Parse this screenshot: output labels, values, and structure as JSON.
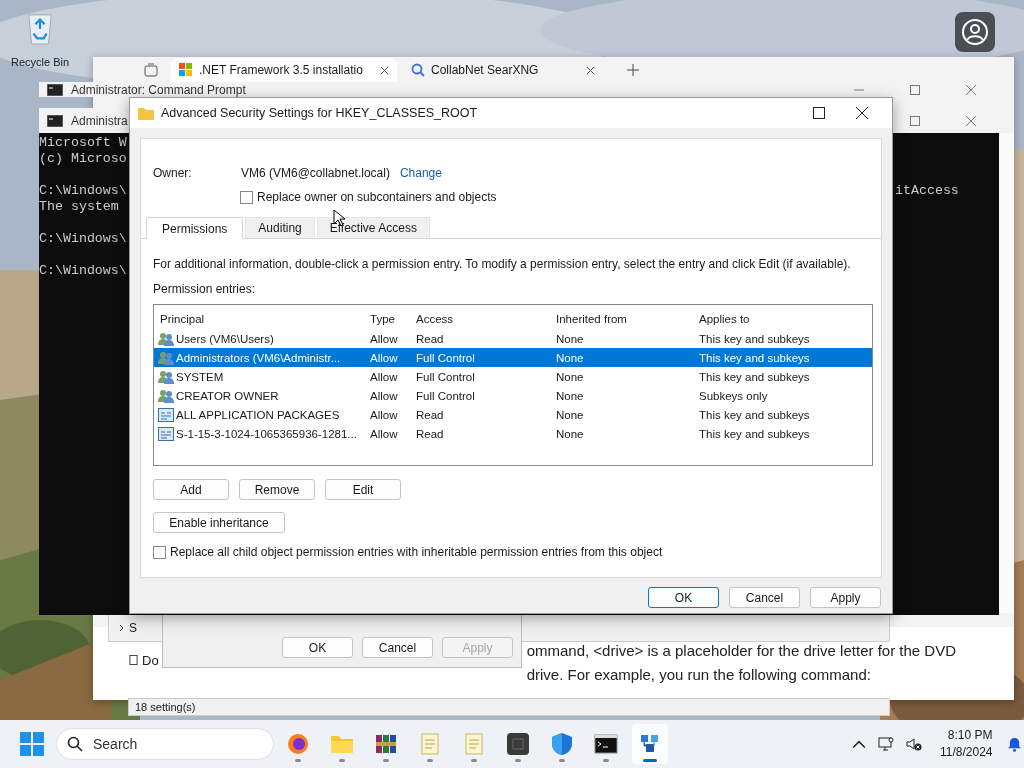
{
  "desktop": {
    "icons": [
      {
        "label": "Recycle Bin"
      }
    ]
  },
  "browser": {
    "tabs": [
      {
        "label": ".NET Framework 3.5 installatio",
        "selected": true,
        "kind": "windows"
      },
      {
        "label": "CollabNet SearXNG",
        "selected": false,
        "kind": "search"
      }
    ],
    "sidebar_item": "Do",
    "article_lines": [
      "ommand, <drive> is a placeholder for the drive letter for the DVD",
      "drive. For example, you run the following command:"
    ]
  },
  "policy_window": {
    "tree_item": "S",
    "status": "18 setting(s)"
  },
  "cmd_windows": [
    {
      "title": "Administrator: Command Prompt"
    },
    {
      "title": "Administra",
      "paragraphs": [
        [
          "Microsoft W",
          "(c) Microso"
        ],
        [
          "C:\\Windows\\",
          "The system"
        ],
        [
          "C:\\Windows\\"
        ],
        [
          "C:\\Windows\\"
        ]
      ],
      "right_fragment": "itAccess"
    }
  ],
  "back_dialog": {
    "buttons": [
      {
        "label": "OK",
        "disabled": false
      },
      {
        "label": "Cancel",
        "disabled": false
      },
      {
        "label": "Apply",
        "disabled": true
      }
    ]
  },
  "dialog": {
    "title": "Advanced Security Settings for HKEY_CLASSES_ROOT",
    "owner_label": "Owner:",
    "owner": "VM6 (VM6@collabnet.local)",
    "owner_link": "Change",
    "replace_owner": {
      "label": "Replace owner on subcontainers and objects",
      "checked": false
    },
    "tabs": [
      {
        "label": "Permissions",
        "selected": true
      },
      {
        "label": "Auditing",
        "selected": false
      },
      {
        "label": "Effective Access",
        "selected": false
      }
    ],
    "info": "For additional information, double-click a permission entry. To modify a permission entry, select the entry and click Edit (if available).",
    "entries_label": "Permission entries:",
    "table": {
      "columns": [
        "Principal",
        "Type",
        "Access",
        "Inherited from",
        "Applies to"
      ],
      "rows": [
        {
          "kind": "group",
          "selected": false,
          "cells": [
            "Users (VM6\\Users)",
            "Allow",
            "Read",
            "None",
            "This key and subkeys"
          ]
        },
        {
          "kind": "group",
          "selected": true,
          "cells": [
            "Administrators (VM6\\Administr...",
            "Allow",
            "Full Control",
            "None",
            "This key and subkeys"
          ]
        },
        {
          "kind": "group",
          "selected": false,
          "cells": [
            "SYSTEM",
            "Allow",
            "Full Control",
            "None",
            "This key and subkeys"
          ]
        },
        {
          "kind": "group",
          "selected": false,
          "cells": [
            "CREATOR OWNER",
            "Allow",
            "Full Control",
            "None",
            "Subkeys only"
          ]
        },
        {
          "kind": "package",
          "selected": false,
          "cells": [
            "ALL APPLICATION PACKAGES",
            "Allow",
            "Read",
            "None",
            "This key and subkeys"
          ]
        },
        {
          "kind": "package",
          "selected": false,
          "cells": [
            "S-1-15-3-1024-1065365936-1281...",
            "Allow",
            "Read",
            "None",
            "This key and subkeys"
          ]
        }
      ]
    },
    "entry_buttons": [
      "Add",
      "Remove",
      "Edit"
    ],
    "inheritance_button": "Enable inheritance",
    "replace_child": {
      "label": "Replace all child object permission entries with inheritable permission entries from this object",
      "checked": false
    },
    "buttons": [
      {
        "label": "OK",
        "default": true
      },
      {
        "label": "Cancel",
        "default": false
      },
      {
        "label": "Apply",
        "default": false
      }
    ]
  },
  "taskbar": {
    "search": {
      "placeholder": "Search"
    },
    "apps": [
      {
        "kind": "firefox",
        "active": false
      },
      {
        "kind": "folder",
        "active": false
      },
      {
        "kind": "archive",
        "active": false
      },
      {
        "kind": "notepad",
        "active": false
      },
      {
        "kind": "notepad",
        "active": false
      },
      {
        "kind": "dark",
        "active": false
      },
      {
        "kind": "shield",
        "active": false
      },
      {
        "kind": "terminal",
        "active": false
      },
      {
        "kind": "network",
        "active": true
      }
    ],
    "time": "8:10 PM",
    "date": "11/8/2024"
  }
}
